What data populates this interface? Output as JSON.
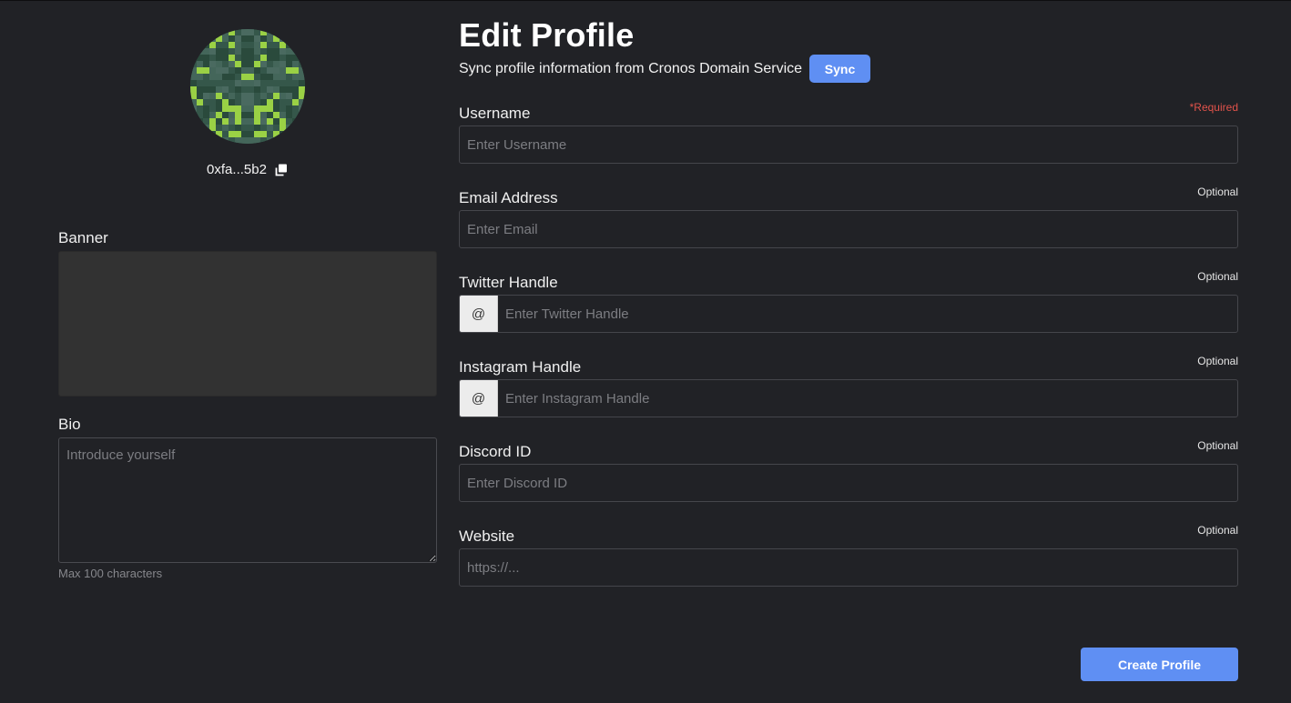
{
  "profile": {
    "address": "0xfa...5b2",
    "avatar_colors": {
      "base": "#35574a",
      "dark": "#2a4a3c",
      "mid": "#44665a",
      "bright": "#9ad145",
      "gray": "#4a6a60"
    }
  },
  "left": {
    "banner_label": "Banner",
    "bio_label": "Bio",
    "bio_placeholder": "Introduce yourself",
    "bio_value": "",
    "bio_hint": "Max 100 characters"
  },
  "header": {
    "title": "Edit Profile",
    "sync_text": "Sync profile information from Cronos Domain Service",
    "sync_button": "Sync"
  },
  "fields": [
    {
      "label": "Username",
      "tag": "*Required",
      "placeholder": "Enter Username",
      "value": "",
      "prefix": ""
    },
    {
      "label": "Email Address",
      "tag": "Optional",
      "placeholder": "Enter Email",
      "value": "",
      "prefix": ""
    },
    {
      "label": "Twitter Handle",
      "tag": "Optional",
      "placeholder": "Enter Twitter Handle",
      "value": "",
      "prefix": "@"
    },
    {
      "label": "Instagram Handle",
      "tag": "Optional",
      "placeholder": "Enter Instagram Handle",
      "value": "",
      "prefix": "@"
    },
    {
      "label": "Discord ID",
      "tag": "Optional",
      "placeholder": "Enter Discord ID",
      "value": "",
      "prefix": ""
    },
    {
      "label": "Website",
      "tag": "Optional",
      "placeholder": "https://...",
      "value": "",
      "prefix": ""
    }
  ],
  "actions": {
    "create_button": "Create Profile"
  },
  "colors": {
    "background": "#212226",
    "accent": "#5f8ff3",
    "required": "#e2534b",
    "banner_fill": "#323232"
  },
  "icons": {
    "copy": "copy-icon",
    "avatar": "identicon-avatar"
  }
}
